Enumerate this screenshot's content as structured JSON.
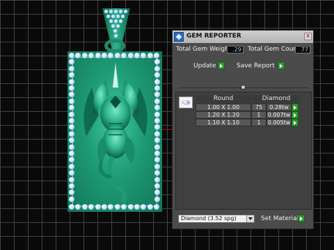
{
  "panel": {
    "title": "GEM REPORTER",
    "close_label": "x",
    "total_weight_label": "Total Gem Weight",
    "total_weight_value": ".29",
    "total_count_label": "Total Gem Count",
    "total_count_value": "77",
    "update_label": "Update",
    "save_report_label": "Save Report",
    "table": {
      "headers": [
        "Round",
        "Diamond"
      ],
      "rows": [
        {
          "size": "1.00 X 1.00",
          "count": "75",
          "weight": "0.28tw"
        },
        {
          "size": "1.20 X 1.20",
          "count": "1",
          "weight": "0.007tw"
        },
        {
          "size": "1.10 X 1.10",
          "count": "1",
          "weight": "0.005tw"
        }
      ]
    },
    "material_select": "Diamond    (3.52 spg)",
    "set_material_label": "Set Material"
  },
  "colors": {
    "panel_bg": "#4b4b4b",
    "go_button": "#2f9a2f",
    "pendant_green": "#1d9a73",
    "gem_blue": "#cfe6ff"
  },
  "icons": [
    "app-icon",
    "close-icon",
    "go-arrow-icon",
    "gem-shape-icon",
    "dropdown-arrow-icon"
  ]
}
